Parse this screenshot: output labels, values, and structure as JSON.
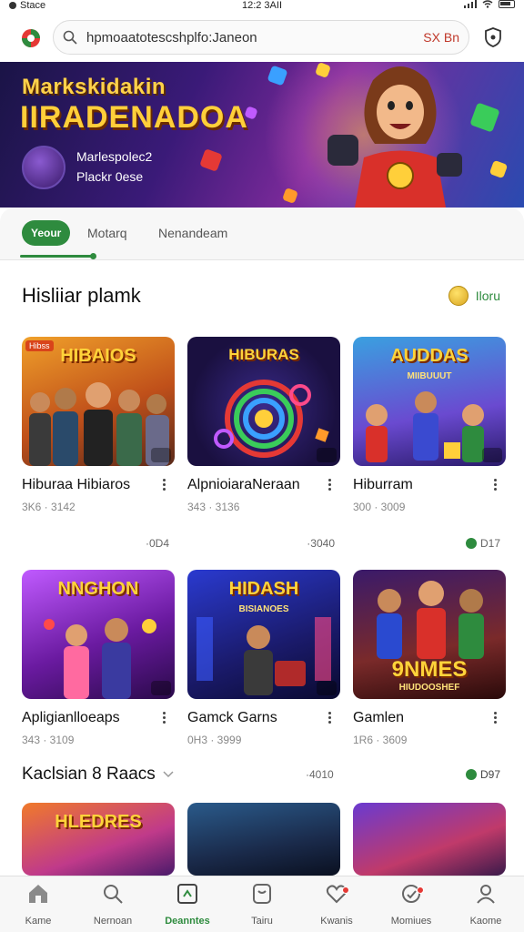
{
  "status_bar": {
    "carrier": "Stace",
    "time": "12:2 3AII"
  },
  "address_bar": {
    "url": "hpmoaatotescshplfo:Janeon",
    "action_label": "SX Bn"
  },
  "banner": {
    "title_line1": "Markskidakin",
    "title_line2": "IIRADENADOA",
    "sub_line1": "Marlespolec2",
    "sub_line2": "Plackr 0ese"
  },
  "tabs": [
    {
      "label": "Yeour",
      "active": true
    },
    {
      "label": "Motarq",
      "active": false
    },
    {
      "label": "Nenandeam",
      "active": false
    }
  ],
  "section1": {
    "title": "Hisliiar plamk",
    "link_label": "Iloru"
  },
  "cards": [
    {
      "name": "Hiburaa Hibiaros",
      "meta": "3K6 · 3142",
      "price": "·0D4",
      "thumb_title": "HIBAIOS",
      "thumb_badge": "Hibss"
    },
    {
      "name": "AlpnioiaraNeraan",
      "meta": "343 · 3136",
      "price": "·3040",
      "thumb_title": "HIBURAS"
    },
    {
      "name": "Hiburram",
      "meta": "300 · 3009",
      "price": "D17",
      "thumb_title": "AUDDAS",
      "thumb_sub": "MIIBUUUT"
    },
    {
      "name": "Apligianlloeaps",
      "meta": "343 · 3109",
      "price": "",
      "thumb_title": "NNGHON"
    },
    {
      "name": "Gamck Garns",
      "meta": "0H3 · 3999",
      "price": "",
      "thumb_title": "HIDASH",
      "thumb_sub": "BISIANOES"
    },
    {
      "name": "Gamlen",
      "meta": "1R6 · 3609",
      "price": "",
      "thumb_title": "9NMES",
      "thumb_sub": "HIUDOOSHEF"
    }
  ],
  "section2": {
    "title": "Kaclsian 8 Raacs",
    "mid_price": "·4010",
    "link_label": "D97"
  },
  "preview_cards": [
    {
      "thumb_title": "HLEDRES"
    },
    {
      "thumb_title": ""
    },
    {
      "thumb_title": ""
    }
  ],
  "bottom_nav": [
    {
      "label": "Kame",
      "icon": "home-icon",
      "active": false
    },
    {
      "label": "Nernoan",
      "icon": "search-icon",
      "active": false
    },
    {
      "label": "Deanntes",
      "icon": "games-icon",
      "active": true
    },
    {
      "label": "Tairu",
      "icon": "bag-icon",
      "active": false
    },
    {
      "label": "Kwanis",
      "icon": "heart-icon",
      "active": false
    },
    {
      "label": "Momiues",
      "icon": "bell-icon",
      "active": false
    },
    {
      "label": "Kaome",
      "icon": "profile-icon",
      "active": false
    }
  ],
  "colors": {
    "accent": "#2e8b3e",
    "banner_gold": "#ffcf3a",
    "banner_bg": "#3a1a78",
    "alert": "#e53935"
  }
}
